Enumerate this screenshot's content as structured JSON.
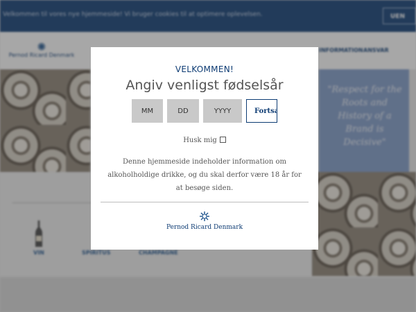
{
  "cookie_bar": {
    "text": "Velkommen til vores nye hjemmeside! Vi bruger cookies til at optimere oplevelsen.",
    "button_label": "UEN"
  },
  "header": {
    "logo_text": "Pernod Ricard Denmark",
    "nav": [
      "INFORMATION",
      "ANSVAR"
    ]
  },
  "hero": {
    "quote": "\"Respect for the Roots and History of a Brand is Decisive\""
  },
  "categories": [
    "VIN",
    "SPIRITUS",
    "CHAMPAGNE"
  ],
  "modal": {
    "welcome": "VELKOMMEN!",
    "heading": "Angiv venligst fødselsår",
    "month_placeholder": "MM",
    "day_placeholder": "DD",
    "year_placeholder": "YYYY",
    "continue_label": "Fortsæt",
    "remember_label": "Husk mig",
    "disclaimer": "Denne hjemmeside indeholder information om alkoholholdige drikke, og du skal derfor være 18 år for at besøge siden.",
    "logo_text": "Pernod Ricard Denmark"
  },
  "colors": {
    "brand_navy": "#0d3b73",
    "input_gray": "#c9c9c9",
    "quote_panel": "#7f9bc9"
  }
}
